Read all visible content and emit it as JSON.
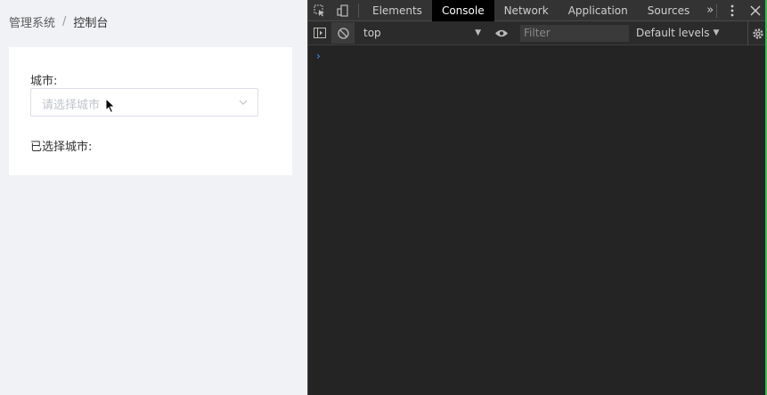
{
  "breadcrumb": {
    "root": "管理系统",
    "separator": "/",
    "current": "控制台"
  },
  "form": {
    "city_label": "城市:",
    "city_placeholder": "请选择城市",
    "selected_label": "已选择城市:"
  },
  "devtools": {
    "tabs": [
      "Elements",
      "Console",
      "Network",
      "Application",
      "Sources"
    ],
    "active_tab": "Console",
    "more_tabs": "»",
    "context": "top",
    "filter_placeholder": "Filter",
    "levels": "Default levels",
    "prompt": "›"
  },
  "colors": {
    "accent": "#409eff",
    "devtools_bg": "#242424",
    "prompt": "#4a8cff"
  }
}
